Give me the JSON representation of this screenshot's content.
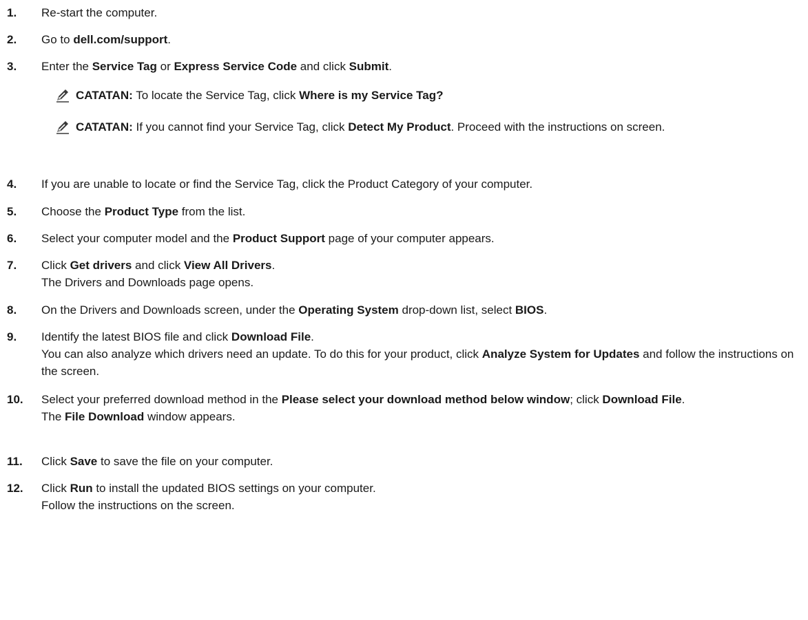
{
  "steps": [
    {
      "num": "1.",
      "parts": [
        {
          "t": "Re-start the computer."
        }
      ]
    },
    {
      "num": "2.",
      "parts": [
        {
          "t": "Go to "
        },
        {
          "t": "dell.com/support",
          "b": true
        },
        {
          "t": "."
        }
      ]
    },
    {
      "num": "3.",
      "parts": [
        {
          "t": "Enter the "
        },
        {
          "t": "Service Tag",
          "b": true
        },
        {
          "t": " or "
        },
        {
          "t": "Express Service Code",
          "b": true
        },
        {
          "t": " and click "
        },
        {
          "t": "Submit",
          "b": true
        },
        {
          "t": "."
        }
      ]
    },
    {
      "num": "4.",
      "parts": [
        {
          "t": "If you are unable to locate or find the Service Tag, click the Product Category of your computer."
        }
      ]
    },
    {
      "num": "5.",
      "parts": [
        {
          "t": "Choose the "
        },
        {
          "t": "Product Type",
          "b": true
        },
        {
          "t": " from the list."
        }
      ]
    },
    {
      "num": "6.",
      "parts": [
        {
          "t": "Select your computer model and the "
        },
        {
          "t": "Product Support",
          "b": true
        },
        {
          "t": " page of your computer appears."
        }
      ]
    },
    {
      "num": "7.",
      "parts": [
        {
          "t": "Click "
        },
        {
          "t": "Get drivers",
          "b": true
        },
        {
          "t": " and click "
        },
        {
          "t": "View All Drivers",
          "b": true
        },
        {
          "t": "."
        }
      ],
      "sub": [
        {
          "t": "The Drivers and Downloads page opens."
        }
      ]
    },
    {
      "num": "8.",
      "parts": [
        {
          "t": "On the Drivers and Downloads screen, under the "
        },
        {
          "t": "Operating System",
          "b": true
        },
        {
          "t": " drop-down list, select "
        },
        {
          "t": "BIOS",
          "b": true
        },
        {
          "t": "."
        }
      ]
    },
    {
      "num": "9.",
      "parts": [
        {
          "t": "Identify the latest BIOS file and click "
        },
        {
          "t": "Download File",
          "b": true
        },
        {
          "t": "."
        }
      ],
      "sub": [
        {
          "t": "You can also analyze which drivers need an update. To do this for your product, click "
        },
        {
          "t": "Analyze System for Updates",
          "b": true
        },
        {
          "t": " and follow the instructions on the screen."
        }
      ]
    },
    {
      "num": "10.",
      "parts": [
        {
          "t": "Select your preferred download method in the "
        },
        {
          "t": "Please select your download method below window",
          "b": true
        },
        {
          "t": "; click "
        },
        {
          "t": "Download File",
          "b": true
        },
        {
          "t": "."
        }
      ],
      "sub": [
        {
          "t": "The "
        },
        {
          "t": "File Download",
          "b": true
        },
        {
          "t": " window appears."
        }
      ]
    },
    {
      "num": "11.",
      "parts": [
        {
          "t": "Click "
        },
        {
          "t": "Save",
          "b": true
        },
        {
          "t": " to save the file on your computer."
        }
      ]
    },
    {
      "num": "12.",
      "parts": [
        {
          "t": "Click "
        },
        {
          "t": "Run",
          "b": true
        },
        {
          "t": " to install the updated BIOS settings on your computer."
        }
      ],
      "sub": [
        {
          "t": "Follow the instructions on the screen."
        }
      ]
    }
  ],
  "notes": [
    {
      "icon": "pencil-note-icon",
      "label": "CATATAN:",
      "parts": [
        {
          "t": " To locate the Service Tag, click "
        },
        {
          "t": "Where is my Service Tag?",
          "b": true
        }
      ]
    },
    {
      "icon": "pencil-note-icon",
      "label": "CATATAN:",
      "parts": [
        {
          "t": " If you cannot find your Service Tag, click "
        },
        {
          "t": "Detect My Product",
          "b": true
        },
        {
          "t": ". Proceed with the instructions on screen."
        }
      ]
    }
  ]
}
